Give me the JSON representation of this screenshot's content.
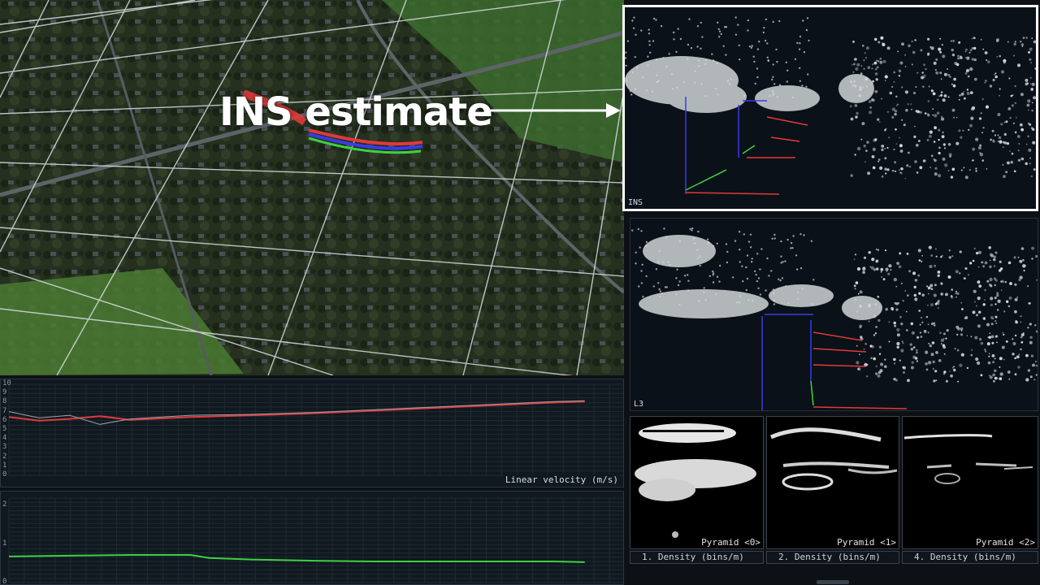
{
  "callout": {
    "label": "INS estimate"
  },
  "views": {
    "ins": {
      "label": "INS"
    },
    "l3": {
      "label": "L3"
    }
  },
  "velocity_chart": {
    "title": "Linear velocity (m/s)",
    "y_ticks": [
      "10",
      "9",
      "8",
      "7",
      "6",
      "5",
      "4",
      "3",
      "2",
      "1",
      "0"
    ],
    "chart_data": {
      "type": "line",
      "ylabel": "Linear velocity (m/s)",
      "ylim": [
        0,
        10
      ],
      "x": [
        0,
        0.05,
        0.1,
        0.15,
        0.2,
        0.3,
        0.4,
        0.5,
        0.6,
        0.7,
        0.8,
        0.9,
        0.95
      ],
      "series": [
        {
          "color": "#e03a3a",
          "values": [
            6.4,
            6.0,
            6.2,
            6.5,
            6.1,
            6.4,
            6.6,
            6.8,
            7.1,
            7.4,
            7.7,
            8.0,
            8.1
          ]
        },
        {
          "color": "#9aa3aa",
          "values": [
            7.0,
            6.3,
            6.6,
            5.6,
            6.2,
            6.6,
            6.7,
            6.9,
            7.2,
            7.5,
            7.8,
            8.1,
            8.2
          ]
        }
      ]
    }
  },
  "second_chart": {
    "y_ticks": [
      "2",
      "1",
      "0"
    ],
    "chart_data": {
      "type": "line",
      "ylim": [
        0,
        2.2
      ],
      "x": [
        0,
        0.1,
        0.2,
        0.3,
        0.33,
        0.4,
        0.5,
        0.6,
        0.7,
        0.8,
        0.9,
        0.95
      ],
      "series": [
        {
          "color": "#3fd13f",
          "values": [
            0.68,
            0.7,
            0.72,
            0.72,
            0.64,
            0.6,
            0.57,
            0.55,
            0.55,
            0.55,
            0.55,
            0.53
          ]
        }
      ]
    }
  },
  "pyramids": [
    {
      "label": "Pyramid <0>"
    },
    {
      "label": "Pyramid <1>"
    },
    {
      "label": "Pyramid <2>"
    }
  ],
  "densities": [
    {
      "label": "1. Density (bins/m)"
    },
    {
      "label": "2. Density (bins/m)"
    },
    {
      "label": "4. Density (bins/m)"
    }
  ],
  "colors": {
    "estimate_red": "#e03a3a",
    "estimate_blue": "#3a3ae8",
    "estimate_green": "#3fd13f",
    "highlight_border": "#ffffff"
  }
}
